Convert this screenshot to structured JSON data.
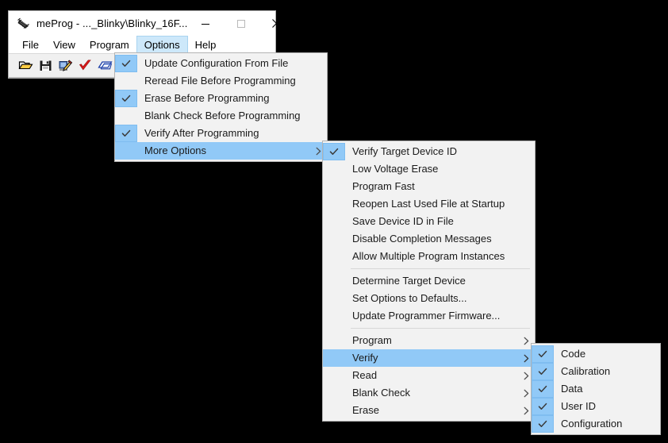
{
  "window": {
    "title": "meProg - ..._Blinky\\Blinky_16F...",
    "icon": "ic-chip-icon",
    "caption_buttons": [
      {
        "name": "minimize-button",
        "glyph": "minimize-icon"
      },
      {
        "name": "maximize-button",
        "glyph": "maximize-icon"
      },
      {
        "name": "close-button",
        "glyph": "close-icon"
      }
    ]
  },
  "menubar": {
    "items": [
      {
        "label": "File",
        "name": "menubar-item-file",
        "active": false
      },
      {
        "label": "View",
        "name": "menubar-item-view",
        "active": false
      },
      {
        "label": "Program",
        "name": "menubar-item-program",
        "active": false
      },
      {
        "label": "Options",
        "name": "menubar-item-options",
        "active": true
      },
      {
        "label": "Help",
        "name": "menubar-item-help",
        "active": false
      }
    ]
  },
  "toolbar": {
    "buttons": [
      {
        "name": "open-file-icon",
        "title": "Open File"
      },
      {
        "name": "save-file-icon",
        "title": "Save File"
      },
      {
        "name": "program-device-icon",
        "title": "Program Device"
      },
      {
        "name": "verify-device-icon",
        "title": "Verify Device"
      },
      {
        "name": "read-device-icon",
        "title": "Read Device"
      },
      {
        "name": "blank-check-icon",
        "title": "Blank Check"
      }
    ]
  },
  "options_menu": {
    "items": [
      {
        "label": "Update Configuration From File",
        "checked": true,
        "submenu": false,
        "highlight": false
      },
      {
        "label": "Reread File Before Programming",
        "checked": false,
        "submenu": false,
        "highlight": false
      },
      {
        "label": "Erase Before Programming",
        "checked": true,
        "submenu": false,
        "highlight": false
      },
      {
        "label": "Blank Check Before Programming",
        "checked": false,
        "submenu": false,
        "highlight": false
      },
      {
        "label": "Verify After Programming",
        "checked": true,
        "submenu": false,
        "highlight": false
      },
      {
        "label": "More Options",
        "checked": false,
        "submenu": true,
        "highlight": true
      }
    ]
  },
  "more_options_menu": {
    "groups": [
      {
        "items": [
          {
            "label": "Verify Target Device ID",
            "checked": true,
            "submenu": false,
            "highlight": false
          },
          {
            "label": "Low Voltage Erase",
            "checked": false,
            "submenu": false,
            "highlight": false
          },
          {
            "label": "Program Fast",
            "checked": false,
            "submenu": false,
            "highlight": false
          },
          {
            "label": "Reopen Last Used File at Startup",
            "checked": false,
            "submenu": false,
            "highlight": false
          },
          {
            "label": "Save Device ID in File",
            "checked": false,
            "submenu": false,
            "highlight": false
          },
          {
            "label": "Disable Completion Messages",
            "checked": false,
            "submenu": false,
            "highlight": false
          },
          {
            "label": "Allow Multiple Program Instances",
            "checked": false,
            "submenu": false,
            "highlight": false
          }
        ]
      },
      {
        "items": [
          {
            "label": "Determine Target Device",
            "checked": false,
            "submenu": false,
            "highlight": false
          },
          {
            "label": "Set Options to Defaults...",
            "checked": false,
            "submenu": false,
            "highlight": false
          },
          {
            "label": "Update Programmer Firmware...",
            "checked": false,
            "submenu": false,
            "highlight": false
          }
        ]
      },
      {
        "items": [
          {
            "label": "Program",
            "checked": false,
            "submenu": true,
            "highlight": false
          },
          {
            "label": "Verify",
            "checked": false,
            "submenu": true,
            "highlight": true
          },
          {
            "label": "Read",
            "checked": false,
            "submenu": true,
            "highlight": false
          },
          {
            "label": "Blank Check",
            "checked": false,
            "submenu": true,
            "highlight": false
          },
          {
            "label": "Erase",
            "checked": false,
            "submenu": true,
            "highlight": false
          }
        ]
      }
    ]
  },
  "verify_menu": {
    "items": [
      {
        "label": "Code",
        "checked": true,
        "submenu": false,
        "highlight": false
      },
      {
        "label": "Calibration",
        "checked": true,
        "submenu": false,
        "highlight": false
      },
      {
        "label": "Data",
        "checked": true,
        "submenu": false,
        "highlight": false
      },
      {
        "label": "User ID",
        "checked": true,
        "submenu": false,
        "highlight": false
      },
      {
        "label": "Configuration",
        "checked": true,
        "submenu": false,
        "highlight": false
      }
    ]
  },
  "colors": {
    "highlight": "#91c9f7",
    "menu_background": "#f2f2f2",
    "menu_border": "#b4b4b4",
    "desktop": "#000000",
    "window_background": "#ffffff",
    "toolbar_background": "#f0f0f0"
  }
}
